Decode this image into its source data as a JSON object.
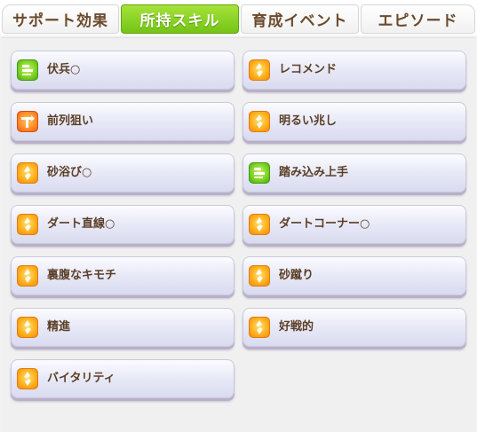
{
  "tabs": [
    {
      "label": "サポート効果",
      "active": false
    },
    {
      "label": "所持スキル",
      "active": true
    },
    {
      "label": "育成イベント",
      "active": false
    },
    {
      "label": "エピソード",
      "active": false
    }
  ],
  "skills": [
    {
      "name": "伏兵○",
      "icon": "green-ladder-icon"
    },
    {
      "name": "レコメンド",
      "icon": "gold-runner-icon"
    },
    {
      "name": "前列狙い",
      "icon": "orange-position-icon"
    },
    {
      "name": "明るい兆し",
      "icon": "gold-runner-icon"
    },
    {
      "name": "砂浴び○",
      "icon": "gold-runner-icon"
    },
    {
      "name": "踏み込み上手",
      "icon": "green-ladder-icon"
    },
    {
      "name": "ダート直線○",
      "icon": "gold-runner-icon"
    },
    {
      "name": "ダートコーナー○",
      "icon": "gold-runner-icon"
    },
    {
      "name": "裏腹なキモチ",
      "icon": "gold-runner-icon"
    },
    {
      "name": "砂蹴り",
      "icon": "gold-runner-icon"
    },
    {
      "name": "精進",
      "icon": "gold-runner-icon"
    },
    {
      "name": "好戦的",
      "icon": "gold-runner-icon"
    },
    {
      "name": "バイタリティ",
      "icon": "gold-runner-icon"
    }
  ],
  "colors": {
    "active_tab": "#7cc81c",
    "tab_text": "#6b4a2c",
    "skill_text": "#5a3e25",
    "card_bg": "#e6e7f6"
  }
}
